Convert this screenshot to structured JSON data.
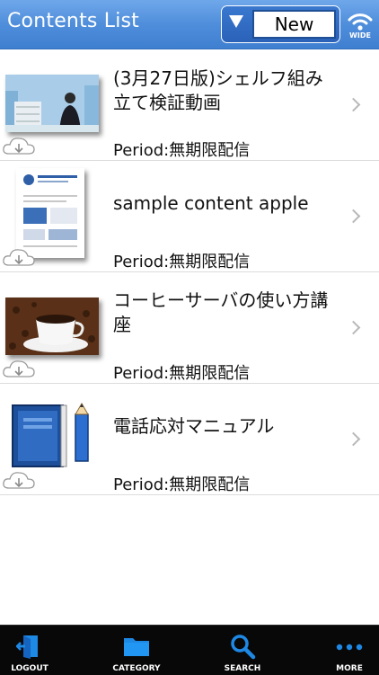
{
  "header": {
    "title": "Contents List",
    "sort_value": "New",
    "wifi_label": "WIDE"
  },
  "items": [
    {
      "title": "(3月27日版)シェルフ組み立て検証動画",
      "period": "Period:無期限配信"
    },
    {
      "title": "sample content apple",
      "period": "Period:無期限配信"
    },
    {
      "title": "コーヒーサーバの使い方講座",
      "period": "Period:無期限配信"
    },
    {
      "title": "電話応対マニュアル",
      "period": "Period:無期限配信"
    }
  ],
  "tabbar": {
    "logout": "LOGOUT",
    "category": "CATEGORY",
    "search": "SEARCH",
    "more": "MORE"
  },
  "colors": {
    "header": "#4f8edb",
    "tabbar": "#080808",
    "icon_blue": "#1e88e5"
  }
}
